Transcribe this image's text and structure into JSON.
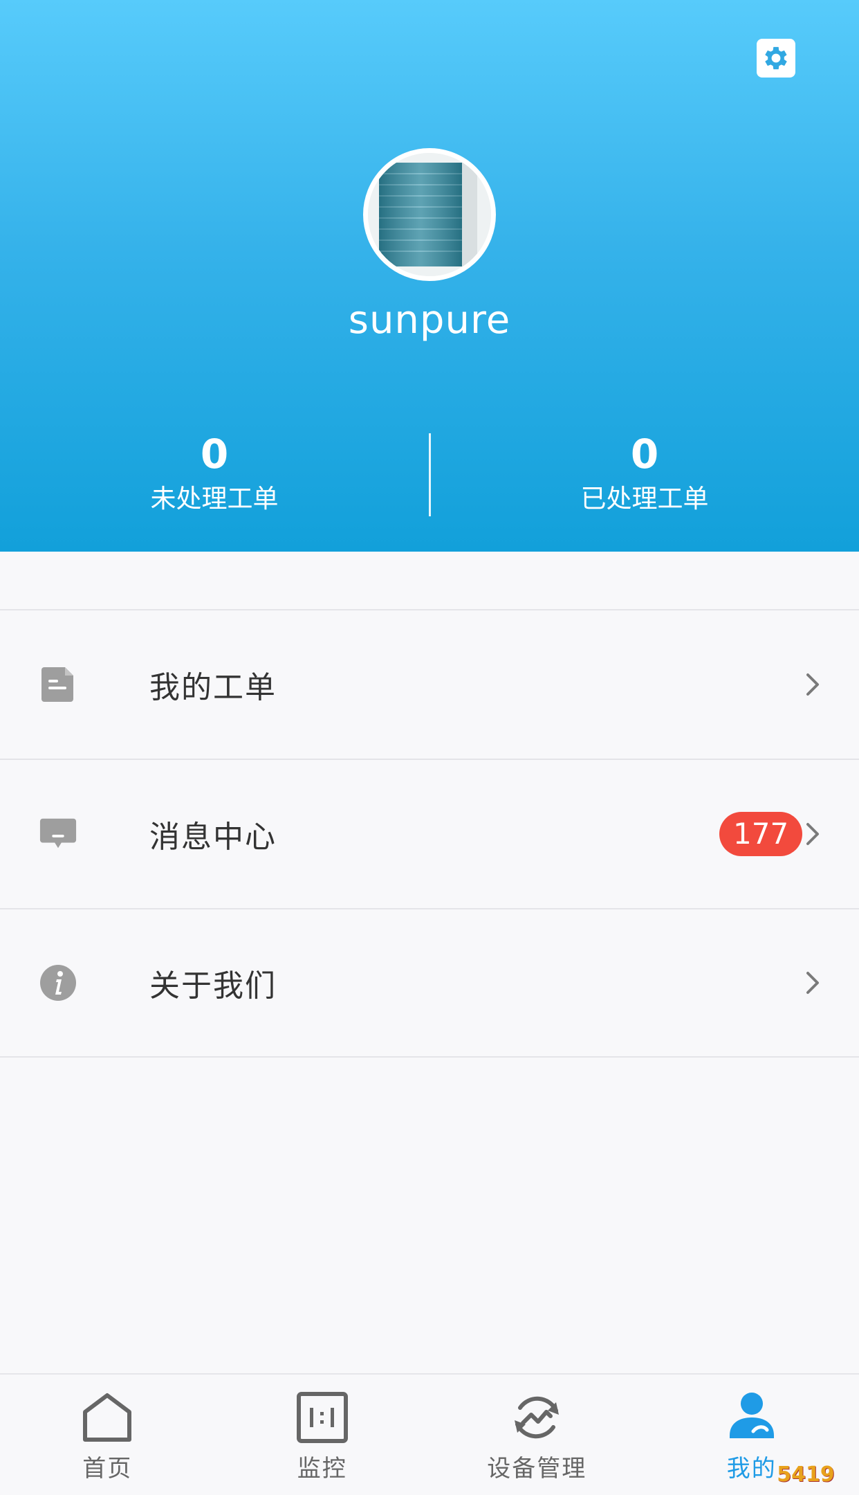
{
  "header": {
    "username": "sunpure",
    "stats": [
      {
        "value": "0",
        "label": "未处理工单"
      },
      {
        "value": "0",
        "label": "已处理工单"
      }
    ]
  },
  "menu": {
    "items": [
      {
        "label": "我的工单",
        "icon": "document-icon"
      },
      {
        "label": "消息中心",
        "icon": "message-icon",
        "badge": "177"
      },
      {
        "label": "关于我们",
        "icon": "info-icon"
      }
    ]
  },
  "tabbar": {
    "tabs": [
      {
        "label": "首页",
        "icon": "home-icon"
      },
      {
        "label": "监控",
        "icon": "monitor-icon"
      },
      {
        "label": "设备管理",
        "icon": "device-management-icon"
      },
      {
        "label": "我的",
        "icon": "profile-icon",
        "active": true
      }
    ]
  },
  "watermark": {
    "text": "5419"
  },
  "colors": {
    "header_top": "#57cbfb",
    "header_bottom": "#12a0da",
    "accent": "#1f9be6",
    "badge": "#f24a3d"
  }
}
